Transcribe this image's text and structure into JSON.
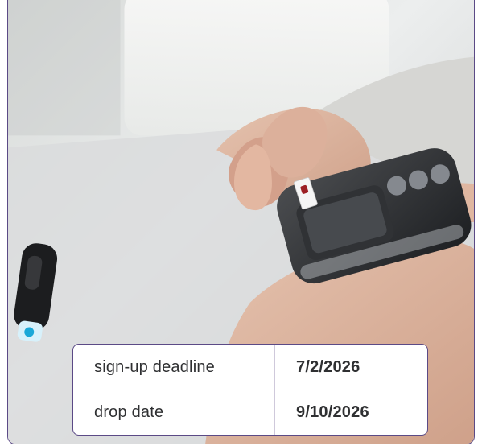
{
  "colors": {
    "accent": "#5b4a86",
    "table_text": "#2f3032",
    "divider": "#cfc9db"
  },
  "photo": {
    "subject": "hands-using-glucose-meter"
  },
  "table": {
    "rows": [
      {
        "label": "sign-up deadline",
        "value": "7/2/2026"
      },
      {
        "label": "drop date",
        "value": "9/10/2026"
      }
    ]
  }
}
